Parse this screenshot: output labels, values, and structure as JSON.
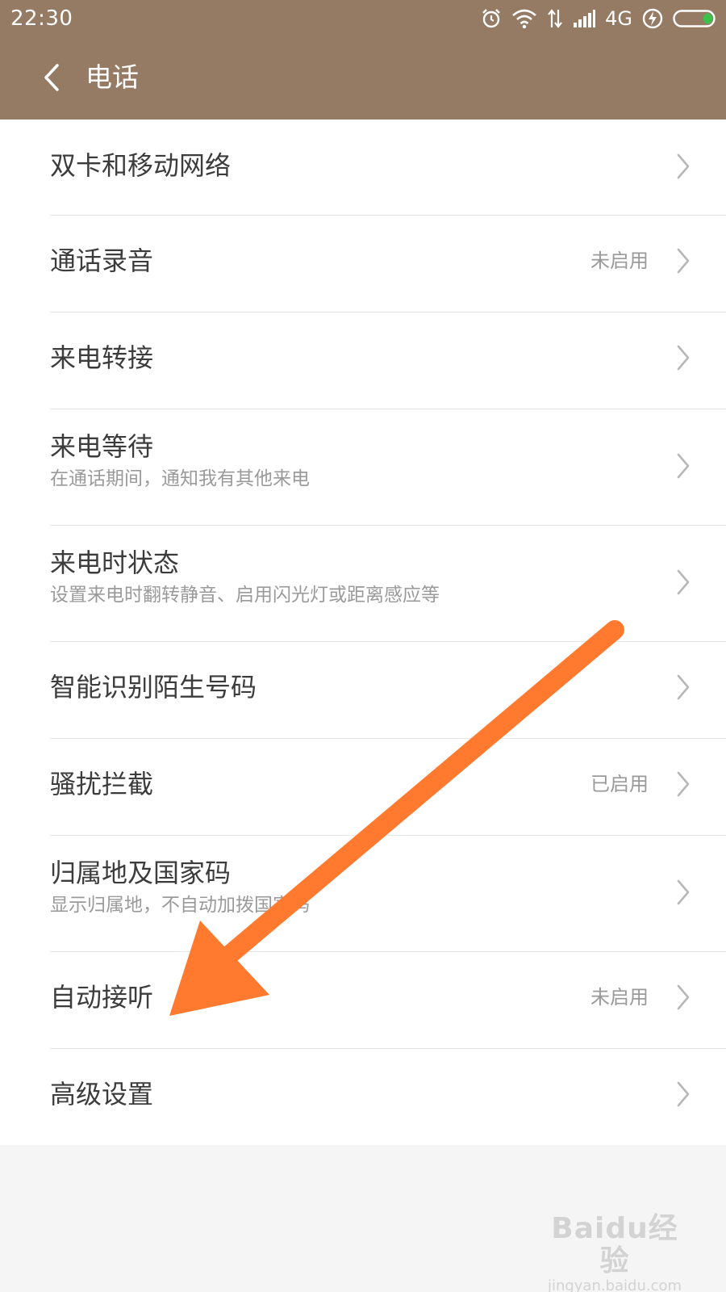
{
  "status_bar": {
    "time": "22:30",
    "network": "4G",
    "icons": [
      "alarm-icon",
      "wifi-icon",
      "data-arrows-icon",
      "signal-icon",
      "network-type",
      "charging-icon",
      "battery-icon"
    ],
    "battery_color": "#39c34a"
  },
  "header": {
    "title": "电话",
    "back_icon": "chevron-left-icon",
    "color": "#957a64"
  },
  "settings": {
    "items": [
      {
        "title": "双卡和移动网络"
      },
      {
        "title": "通话录音",
        "value": "未启用"
      },
      {
        "title": "来电转接"
      },
      {
        "title": "来电等待",
        "subtitle": "在通话期间，通知我有其他来电"
      },
      {
        "title": "来电时状态",
        "subtitle": "设置来电时翻转静音、启用闪光灯或距离感应等"
      },
      {
        "title": "智能识别陌生号码"
      },
      {
        "title": "骚扰拦截",
        "value": "已启用"
      },
      {
        "title": "归属地及国家码",
        "subtitle": "显示归属地，不自动加拨国家码"
      },
      {
        "title": "自动接听",
        "value": "未启用"
      },
      {
        "title": "高级设置"
      }
    ]
  },
  "annotation": {
    "arrow_color": "#ff7a2e"
  },
  "watermark": {
    "brand": "Baidu经验",
    "url": "jingyan.baidu.com"
  }
}
